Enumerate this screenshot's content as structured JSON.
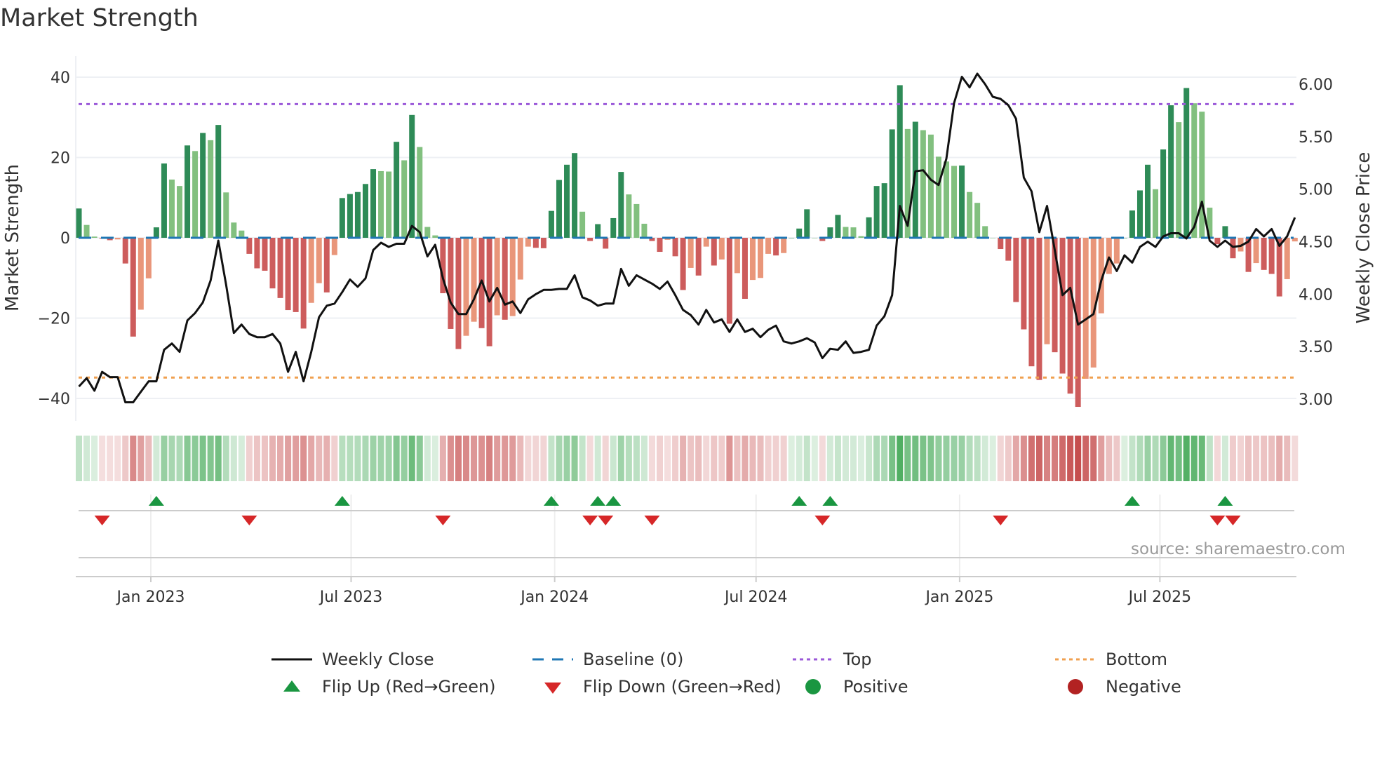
{
  "title": "Market Strength",
  "source": "source: sharemaestro.com",
  "colors": {
    "pos_up": "#2e8b57",
    "pos_down": "#82c07f",
    "neg_down": "#cd5c5c",
    "neg_up": "#e9967a",
    "close": "#111111",
    "baseline": "#1f77b4",
    "top": "#9b59d9",
    "bottom": "#f0a050",
    "flip_up": "#1a9641",
    "flip_down": "#d62728",
    "positive": "#1a9641",
    "negative": "#b22222"
  },
  "chart_data": {
    "type": "bar",
    "title": "Market Strength",
    "ylabel": "Market Strength",
    "y2label": "Weekly Close Price",
    "ylim": [
      -45,
      45
    ],
    "y2lim": [
      2.87,
      6.13
    ],
    "yticks": [
      "40",
      "20",
      "0",
      "-20",
      "-40"
    ],
    "y2ticks": [
      "6.00",
      "5.50",
      "5.00",
      "4.50",
      "4.00",
      "3.50",
      "3.00"
    ],
    "x_start": "2022-10-28",
    "x_step_days": 7,
    "xticks": [
      {
        "label": "Jan 2023",
        "date": "2023-01-01"
      },
      {
        "label": "Jul 2023",
        "date": "2023-07-01"
      },
      {
        "label": "Jan 2024",
        "date": "2024-01-01"
      },
      {
        "label": "Jul 2024",
        "date": "2024-07-01"
      },
      {
        "label": "Jan 2025",
        "date": "2025-01-01"
      },
      {
        "label": "Jul 2025",
        "date": "2025-07-01"
      }
    ],
    "top_level": 33.3,
    "bottom_level": -34.8,
    "baseline": 0,
    "strength": [
      7.3,
      3.2,
      0.3,
      -0.2,
      -0.6,
      -0.4,
      -6.4,
      -24.6,
      -17.9,
      -10.1,
      2.6,
      18.5,
      14.5,
      12.9,
      23,
      21.6,
      26.1,
      24.3,
      28.1,
      11.3,
      3.8,
      1.8,
      -4.0,
      -7.6,
      -8.2,
      -12.6,
      -15.0,
      -18.0,
      -18.5,
      -22.6,
      -16.2,
      -11.3,
      -13.6,
      -4.3,
      9.9,
      10.9,
      11.4,
      13.4,
      17.1,
      16.6,
      16.5,
      23.9,
      19.3,
      30.6,
      22.6,
      2.7,
      0.6,
      -13.8,
      -22.7,
      -27.7,
      -24.4,
      -20.9,
      -22.5,
      -27,
      -19.3,
      -20.4,
      -19.5,
      -10.4,
      -2.2,
      -2.5,
      -2.6,
      6.7,
      14.4,
      18.2,
      21.1,
      6.5,
      -0.8,
      3.4,
      -2.7,
      4.9,
      16.4,
      10.8,
      8.4,
      3.5,
      -0.8,
      -3.5,
      -0.5,
      -4.6,
      -13,
      -7.5,
      -9.4,
      -2.2,
      -6.9,
      -5.4,
      -21.4,
      -8.8,
      -15.2,
      -10.5,
      -10,
      -4,
      -4.4,
      -3.8,
      0,
      2.3,
      7.1,
      0,
      -0.8,
      2.6,
      5.7,
      2.7,
      2.6,
      0.4,
      5.1,
      12.9,
      13.6,
      27,
      38,
      27.1,
      28.9,
      26.8,
      25.7,
      20.2,
      19,
      17.9,
      18.0,
      11.4,
      8.7,
      2.9,
      0,
      -2.8,
      -5.7,
      -16,
      -22.8,
      -32,
      -35.4,
      -26.5,
      -28.5,
      -33.8,
      -38.8,
      -42.1,
      -35.1,
      -32.3,
      -18.8,
      -9,
      -6.4,
      0,
      6.8,
      11.8,
      18.2,
      12.1,
      22,
      33,
      28.8,
      37.3,
      33.5,
      31.4,
      7.5,
      -1.6,
      2.9,
      -5.1,
      -3.4,
      -8.5,
      -6.3,
      -8,
      -9,
      -14.6,
      -10.3,
      -0.9
    ],
    "close": [
      3.12,
      3.2,
      3.08,
      3.26,
      3.21,
      3.21,
      2.97,
      2.97,
      3.07,
      3.17,
      3.17,
      3.47,
      3.53,
      3.45,
      3.75,
      3.82,
      3.92,
      4.13,
      4.51,
      4.09,
      3.63,
      3.71,
      3.62,
      3.59,
      3.59,
      3.62,
      3.53,
      3.26,
      3.45,
      3.17,
      3.45,
      3.78,
      3.89,
      3.91,
      4.02,
      4.14,
      4.07,
      4.15,
      4.42,
      4.49,
      4.45,
      4.48,
      4.48,
      4.65,
      4.59,
      4.36,
      4.47,
      4.15,
      3.92,
      3.81,
      3.81,
      3.95,
      4.13,
      3.93,
      4.06,
      3.9,
      3.93,
      3.82,
      3.95,
      4.0,
      4.04,
      4.04,
      4.05,
      4.05,
      4.18,
      3.97,
      3.94,
      3.89,
      3.91,
      3.91,
      4.24,
      4.08,
      4.18,
      4.14,
      4.1,
      4.05,
      4.12,
      3.99,
      3.85,
      3.8,
      3.71,
      3.85,
      3.73,
      3.76,
      3.64,
      3.76,
      3.64,
      3.67,
      3.59,
      3.66,
      3.7,
      3.55,
      3.53,
      3.55,
      3.58,
      3.54,
      3.39,
      3.48,
      3.47,
      3.55,
      3.44,
      3.45,
      3.47,
      3.7,
      3.79,
      3.99,
      4.84,
      4.65,
      5.17,
      5.18,
      5.09,
      5.04,
      5.29,
      5.82,
      6.07,
      5.97,
      6.1,
      6.0,
      5.88,
      5.86,
      5.8,
      5.67,
      5.11,
      4.98,
      4.59,
      4.84,
      4.42,
      3.99,
      4.06,
      3.71,
      3.76,
      3.81,
      4.13,
      4.35,
      4.22,
      4.37,
      4.3,
      4.45,
      4.5,
      4.45,
      4.55,
      4.58,
      4.58,
      4.53,
      4.64,
      4.88,
      4.51,
      4.45,
      4.51,
      4.45,
      4.46,
      4.5,
      4.62,
      4.55,
      4.62,
      4.46,
      4.55,
      4.73
    ],
    "flip_up_idx": [
      10,
      34,
      61,
      67,
      69,
      93,
      97,
      136,
      148
    ],
    "flip_down_idx": [
      3,
      22,
      47,
      66,
      68,
      74,
      96,
      119,
      147,
      149
    ]
  },
  "legend": {
    "weekly_close": "Weekly Close",
    "baseline": "Baseline (0)",
    "top": "Top",
    "bottom": "Bottom",
    "flip_up": "Flip Up (Red→Green)",
    "flip_down": "Flip Down (Green→Red)",
    "positive": "Positive",
    "negative": "Negative"
  }
}
